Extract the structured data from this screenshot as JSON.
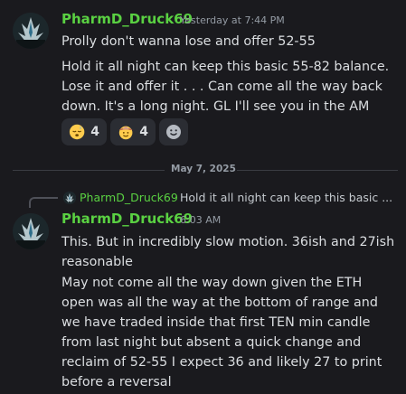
{
  "colors": {
    "background": "#1a1a1e",
    "username": "#5ad142",
    "text": "#dbdee1",
    "muted": "#949ba4",
    "reaction_bg": "#2b2d33"
  },
  "message1": {
    "username": "PharmD_Druck69",
    "timestamp": "Yesterday at 7:44 PM",
    "line1": "Prolly don't wanna lose and offer 52-55",
    "line2": "Hold it all night can keep this basic 55-82 balance. Lose it and offer it . . . Can come all the way back down. It's a long night. GL I'll see you in the AM",
    "reactions": [
      {
        "emoji": "sleeping-face-icon",
        "count": "4"
      },
      {
        "emoji": "cowboy-face-icon",
        "count": "4"
      }
    ],
    "add_reaction_icon": "add-reaction-icon"
  },
  "date_divider": "May 7, 2025",
  "message2": {
    "reply_username": "PharmD_Druck69",
    "reply_preview": "Hold it all night can keep this basic ...",
    "username": "PharmD_Druck69",
    "timestamp": "6:03 AM",
    "line1": "This. But in incredibly slow motion. 36ish and 27ish reasonable",
    "line2": "May not come all the way down given the ETH open was all the way at the bottom of range and we have traded inside that first TEN min candle from last night but absent a quick change and reclaim of 52-55 I expect 36 and likely 27 to print before a reversal"
  }
}
